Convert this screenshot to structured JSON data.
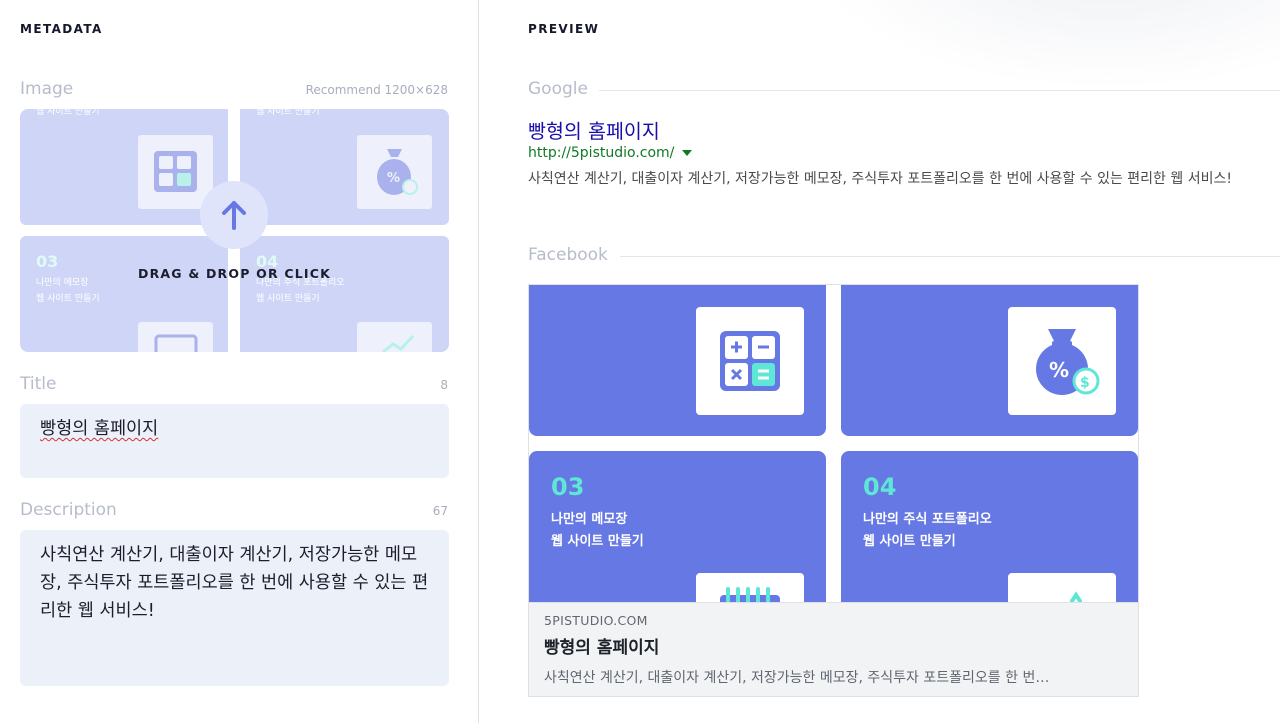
{
  "metadata": {
    "heading": "METADATA",
    "image": {
      "label": "Image",
      "hint": "Recommend 1200×628",
      "dropzone_label": "DRAG & DROP OR CLICK"
    },
    "title": {
      "label": "Title",
      "count": "8",
      "value": "빵형의 홈페이지"
    },
    "description": {
      "label": "Description",
      "count": "67",
      "value": "사칙연산 계산기, 대출이자 계산기, 저장가능한 메모장, 주식투자 포트폴리오를 한 번에 사용할 수 있는 편리한 웹 서비스!"
    }
  },
  "preview": {
    "heading": "PREVIEW",
    "google": {
      "label": "Google",
      "title": "빵형의 홈페이지",
      "url": "http://5pistudio.com/",
      "description": "사칙연산 계산기, 대출이자 계산기, 저장가능한 메모장, 주식투자 포트폴리오를 한 번에 사용할 수 있는 편리한 웹 서비스!"
    },
    "facebook": {
      "label": "Facebook",
      "domain": "5PISTUDIO.COM",
      "title": "빵형의 홈페이지",
      "description": "사칙연산 계산기, 대출이자 계산기, 저장가능한 메모장, 주식투자 포트폴리오를 한 번…"
    }
  },
  "og_image": {
    "tile1_caption": "웹 사이트 만들기",
    "tile2_caption": "웹 사이트 만들기",
    "tile3_number": "03",
    "tile3_line1": "나만의 메모장",
    "tile3_line2": "웹 사이트 만들기",
    "tile4_number": "04",
    "tile4_line1": "나만의 주식 포트폴리오",
    "tile4_line2": "웹 사이트 만들기"
  },
  "colors": {
    "accent_blue": "#6578e3",
    "accent_teal": "#5ee6d6",
    "google_link": "#1a0dab",
    "google_url": "#0f7a25",
    "input_bg": "#ecf0f9",
    "dropzone_tint": "#cfd5f6"
  },
  "icons": [
    "upload-arrow-icon",
    "calculator-icon",
    "money-bag-icon",
    "notepad-icon",
    "chart-icon",
    "dropdown-caret-icon"
  ]
}
